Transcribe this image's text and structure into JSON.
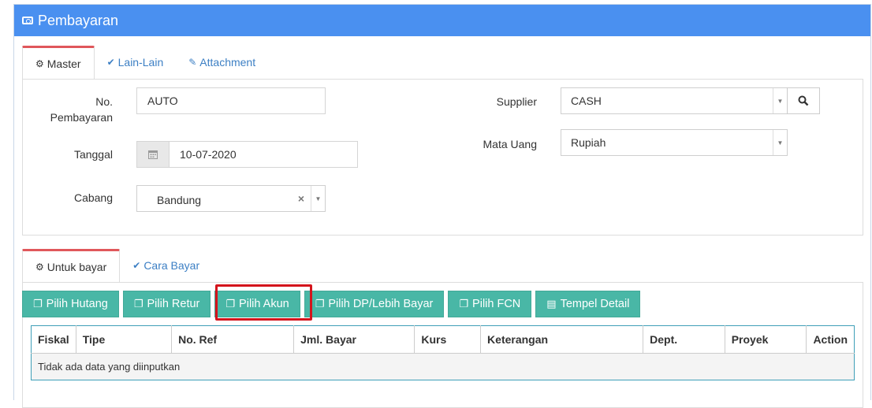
{
  "header": {
    "title": "Pembayaran",
    "icon": "money-icon"
  },
  "top_tabs": [
    {
      "label": "Master",
      "icon": "gears-icon",
      "active": true
    },
    {
      "label": "Lain-Lain",
      "icon": "check-circle-icon",
      "active": false
    },
    {
      "label": "Attachment",
      "icon": "paperclip-icon",
      "active": false
    }
  ],
  "form": {
    "no_pembayaran_label_1": "No.",
    "no_pembayaran_label_2": "Pembayaran",
    "no_pembayaran_value": "AUTO",
    "tanggal_label": "Tanggal",
    "tanggal_value": "10-07-2020",
    "cabang_label": "Cabang",
    "cabang_value": "Bandung",
    "supplier_label": "Supplier",
    "supplier_value": "CASH",
    "mata_uang_label": "Mata Uang",
    "mata_uang_value": "Rupiah"
  },
  "bottom_tabs": [
    {
      "label": "Untuk bayar",
      "icon": "gears-icon",
      "active": true
    },
    {
      "label": "Cara Bayar",
      "icon": "check-circle-icon",
      "active": false
    }
  ],
  "buttons": [
    {
      "label": "Pilih Hutang",
      "icon": "copy-icon"
    },
    {
      "label": "Pilih Retur",
      "icon": "copy-icon"
    },
    {
      "label": "Pilih Akun",
      "icon": "copy-icon"
    },
    {
      "label": "Pilih DP/Lebih Bayar",
      "icon": "copy-icon"
    },
    {
      "label": "Pilih FCN",
      "icon": "copy-icon"
    },
    {
      "label": "Tempel Detail",
      "icon": "paste-icon"
    }
  ],
  "table": {
    "columns": [
      "Fiskal",
      "Tipe",
      "No. Ref",
      "Jml. Bayar",
      "Kurs",
      "Keterangan",
      "Dept.",
      "Proyek",
      "Action"
    ],
    "empty_message": "Tidak ada data yang diinputkan"
  },
  "colors": {
    "header": "#4a90f0",
    "button": "#49b7a6",
    "highlight": "#d4141c",
    "tab_accent": "#e0575b"
  }
}
